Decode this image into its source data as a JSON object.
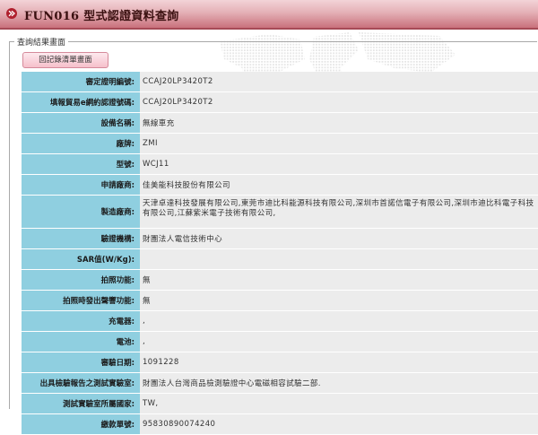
{
  "header": {
    "title": "FUN016 型式認證資料查詢"
  },
  "section": {
    "legend": "查詢結果畫面"
  },
  "buttons": {
    "back_label": "回記錄清單畫面"
  },
  "colors": {
    "label_bg": "#8fcfe0",
    "value_bg": "#ececec",
    "title_accent": "#c9717c",
    "button_bg": "#f6c0cb"
  },
  "icons": {
    "title_icon": "double-arrow-right-icon"
  },
  "rows": [
    {
      "label": "審定證明編號:",
      "value": "CCAJ20LP3420T2"
    },
    {
      "label": "填報貿易e網約認證號碼:",
      "value": "CCAJ20LP3420T2"
    },
    {
      "label": "設備名稱:",
      "value": "無線車充"
    },
    {
      "label": "廠牌:",
      "value": "ZMI"
    },
    {
      "label": "型號:",
      "value": "WCJ11"
    },
    {
      "label": "申請廠商:",
      "value": "佳美能科技股份有限公司"
    },
    {
      "label": "製造廠商:",
      "value": "天津卓達科技發展有限公司,東莞市迪比科能源科技有限公司,深圳市首諾信電子有限公司,深圳市迪比科電子科技有限公司,江蘇紫米電子技術有限公司,"
    },
    {
      "label": "驗證機構:",
      "value": "財團法人電信技術中心"
    },
    {
      "label": "SAR值(W/Kg):",
      "value": ""
    },
    {
      "label": "拍照功能:",
      "value": "無"
    },
    {
      "label": "拍照時發出聲響功能:",
      "value": "無"
    },
    {
      "label": "充電器:",
      "value": ","
    },
    {
      "label": "電池:",
      "value": ","
    },
    {
      "label": "審驗日期:",
      "value": "1091228"
    },
    {
      "label": "出具檢驗報告之測試實驗室:",
      "value": "財團法人台灣商品檢測驗證中心電磁相容試驗二部."
    },
    {
      "label": "測試實驗室所屬國家:",
      "value": "TW,"
    },
    {
      "label": "繳款單號:",
      "value": "95830890074240"
    }
  ]
}
